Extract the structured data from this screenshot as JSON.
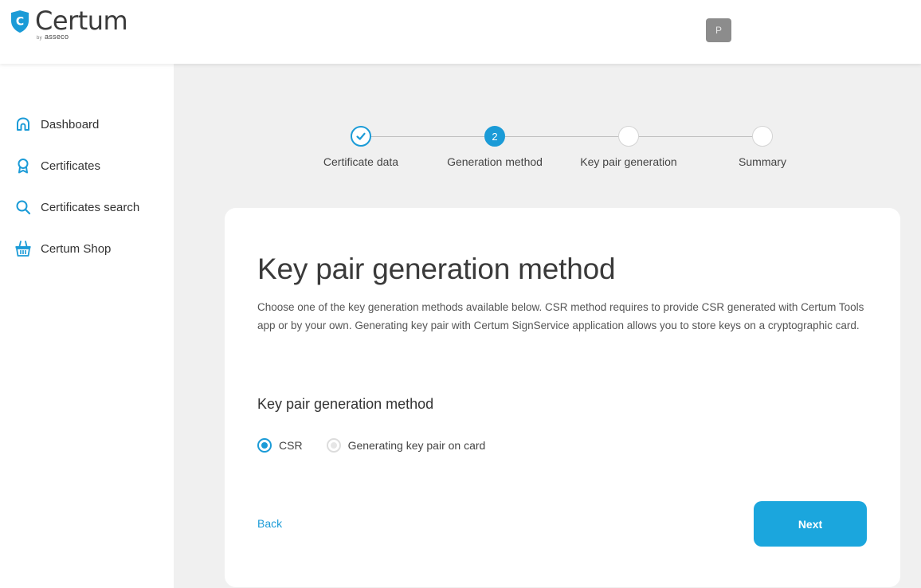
{
  "header": {
    "logo_name": "Certum",
    "logo_by": "by",
    "logo_sub": "asseco",
    "avatar_initial": "P"
  },
  "sidebar": {
    "items": [
      {
        "label": "Dashboard",
        "icon": "home-icon"
      },
      {
        "label": "Certificates",
        "icon": "award-icon"
      },
      {
        "label": "Certificates search",
        "icon": "search-icon"
      },
      {
        "label": "Certum Shop",
        "icon": "basket-icon"
      }
    ]
  },
  "stepper": {
    "steps": [
      {
        "label": "Certificate data",
        "state": "done",
        "number": ""
      },
      {
        "label": "Generation method",
        "state": "active",
        "number": "2"
      },
      {
        "label": "Key pair generation",
        "state": "todo",
        "number": ""
      },
      {
        "label": "Summary",
        "state": "todo",
        "number": ""
      }
    ]
  },
  "card": {
    "title": "Key pair generation method",
    "description": "Choose one of the key generation methods available below. CSR method requires to provide CSR generated with Certum Tools app or by your own. Generating key pair with Certum SignService application allows you to store keys on a cryptographic card.",
    "subtitle": "Key pair generation method",
    "options": [
      {
        "label": "CSR",
        "selected": true
      },
      {
        "label": "Generating key pair on card",
        "selected": false
      }
    ],
    "back_label": "Back",
    "next_label": "Next"
  },
  "colors": {
    "accent": "#1b9bd7",
    "button": "#1ba6dd",
    "background": "#f0f0f0"
  }
}
